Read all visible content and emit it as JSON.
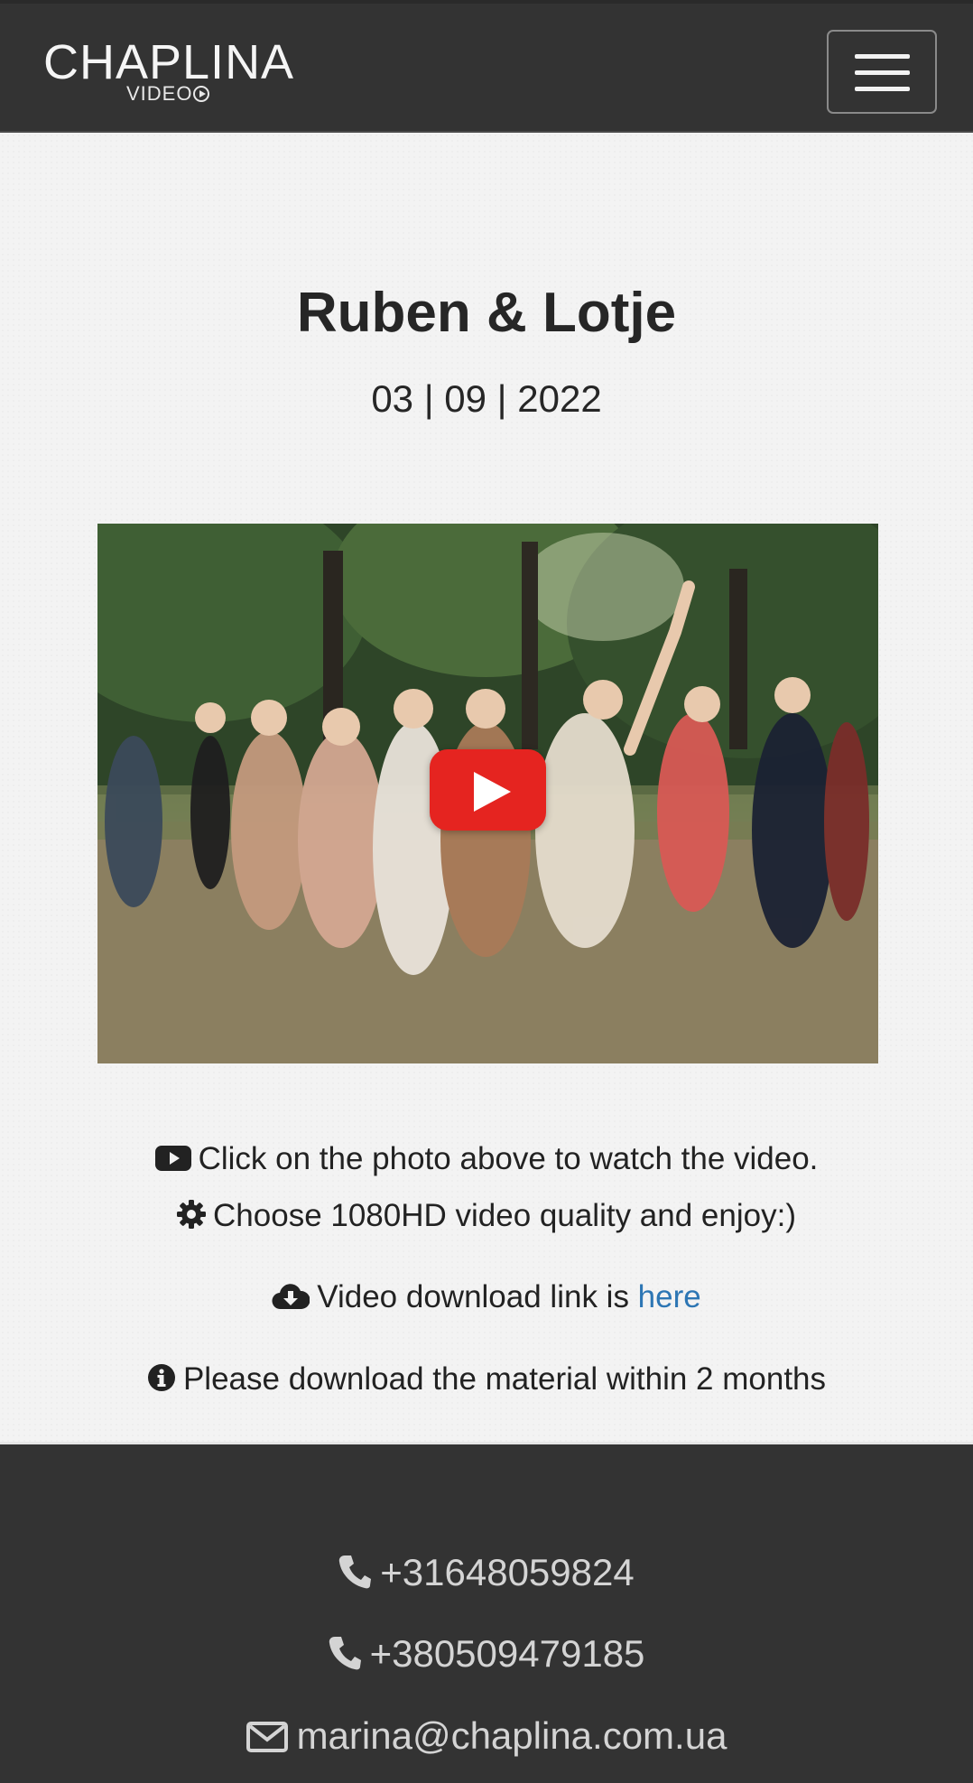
{
  "brand": {
    "logo_main": "CHAPLINA",
    "logo_sub": "VIDEO"
  },
  "header": {
    "menu_icon": "hamburger-menu-icon"
  },
  "main": {
    "title": "Ruben & Lotje",
    "date": "03 | 09 | 2022",
    "video": {
      "play_icon": "youtube-play-icon"
    },
    "lines": {
      "watch": "Click on the photo above to watch the video.",
      "quality": "Choose 1080HD video quality and enjoy:)",
      "download_prefix": "Video download link is ",
      "download_link": "here",
      "notice": "Please download the material within 2 months"
    },
    "icons": {
      "watch": "youtube-icon",
      "quality": "gear-icon",
      "download": "cloud-download-icon",
      "notice": "info-circle-icon"
    }
  },
  "footer": {
    "phone_1": "+31648059824",
    "phone_2": "+380509479185",
    "email": "marina@chaplina.com.ua",
    "icons": {
      "phone": "phone-icon",
      "email": "envelope-icon"
    }
  },
  "colors": {
    "nav_bg": "#333333",
    "page_bg": "#f3f3f3",
    "link": "#2d76b4",
    "play_red": "#e52420",
    "footer_text": "#d4d4d4"
  }
}
